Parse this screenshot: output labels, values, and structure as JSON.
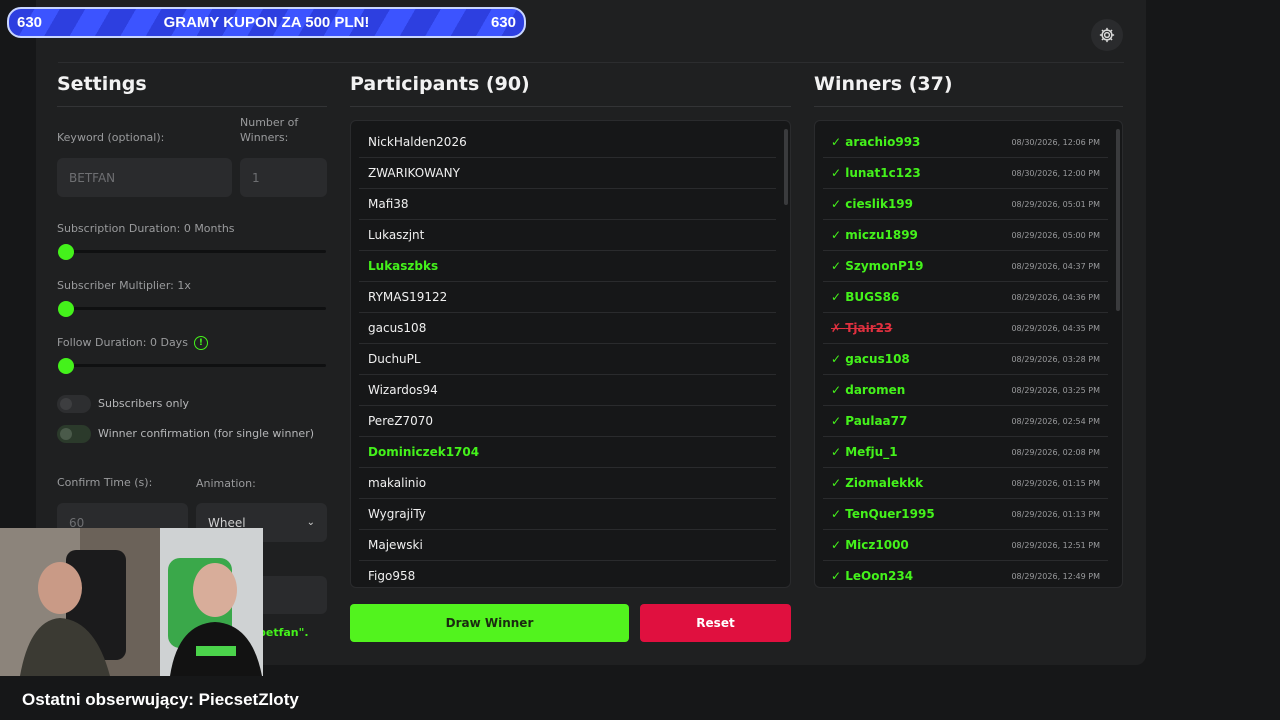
{
  "banner": {
    "left_count": "630",
    "text": "GRAMY KUPON ZA 500 PLN!",
    "right_count": "630"
  },
  "settings": {
    "title": "Settings",
    "keyword_label": "Keyword (optional):",
    "keyword_placeholder": "BETFAN",
    "winners_label_1": "Number of",
    "winners_label_2": "Winners:",
    "winners_value": "1",
    "sub_duration_label": "Subscription Duration: 0 Months",
    "sub_multiplier_label": "Subscriber Multiplier: 1x",
    "follow_label": "Follow Duration:  0  Days",
    "subscribers_only": "Subscribers only",
    "winner_confirmation": "Winner confirmation (for single winner)",
    "confirm_time_label": "Confirm Time (s):",
    "confirm_time_value": "60",
    "animation_label": "Animation:",
    "animation_value": "Wheel",
    "keyword_hint": "betfan\"."
  },
  "participants": {
    "title": "Participants (90)",
    "items": [
      {
        "name": "NickHalden2026",
        "hl": false
      },
      {
        "name": "ZWARIKOWANY",
        "hl": false
      },
      {
        "name": "Mafi38",
        "hl": false
      },
      {
        "name": "Lukaszjnt",
        "hl": false
      },
      {
        "name": "Lukaszbks",
        "hl": true
      },
      {
        "name": "RYMAS19122",
        "hl": false
      },
      {
        "name": "gacus108",
        "hl": false
      },
      {
        "name": "DuchuPL",
        "hl": false
      },
      {
        "name": "Wizardos94",
        "hl": false
      },
      {
        "name": "PereZ7070",
        "hl": false
      },
      {
        "name": "Dominiczek1704",
        "hl": true
      },
      {
        "name": "makalinio",
        "hl": false
      },
      {
        "name": "WygrajiTy",
        "hl": false
      },
      {
        "name": "Majewski",
        "hl": false
      },
      {
        "name": "Figo958",
        "hl": false
      }
    ]
  },
  "winners": {
    "title": "Winners (37)",
    "items": [
      {
        "name": "arachio993",
        "date": "08/30/2026, 12:06 PM",
        "ok": true
      },
      {
        "name": "lunat1c123",
        "date": "08/30/2026, 12:00 PM",
        "ok": true
      },
      {
        "name": "cieslik199",
        "date": "08/29/2026, 05:01 PM",
        "ok": true
      },
      {
        "name": "miczu1899",
        "date": "08/29/2026, 05:00 PM",
        "ok": true
      },
      {
        "name": "SzymonP19",
        "date": "08/29/2026, 04:37 PM",
        "ok": true
      },
      {
        "name": "BUGS86",
        "date": "08/29/2026, 04:36 PM",
        "ok": true
      },
      {
        "name": "Tjair23",
        "date": "08/29/2026, 04:35 PM",
        "ok": false
      },
      {
        "name": "gacus108",
        "date": "08/29/2026, 03:28 PM",
        "ok": true
      },
      {
        "name": "daromen",
        "date": "08/29/2026, 03:25 PM",
        "ok": true
      },
      {
        "name": "Paulaa77",
        "date": "08/29/2026, 02:54 PM",
        "ok": true
      },
      {
        "name": "Mefju_1",
        "date": "08/29/2026, 02:08 PM",
        "ok": true
      },
      {
        "name": "Ziomalekkk",
        "date": "08/29/2026, 01:15 PM",
        "ok": true
      },
      {
        "name": "TenQuer1995",
        "date": "08/29/2026, 01:13 PM",
        "ok": true
      },
      {
        "name": "Micz1000",
        "date": "08/29/2026, 12:51 PM",
        "ok": true
      },
      {
        "name": "LeOon234",
        "date": "08/29/2026, 12:49 PM",
        "ok": true
      }
    ]
  },
  "buttons": {
    "draw": "Draw Winner",
    "reset": "Reset"
  },
  "footer": "Ostatni obserwujący: PiecsetZloty",
  "colors": {
    "accent": "#44f21b",
    "danger": "#e0103f",
    "panel": "#1f2021"
  }
}
